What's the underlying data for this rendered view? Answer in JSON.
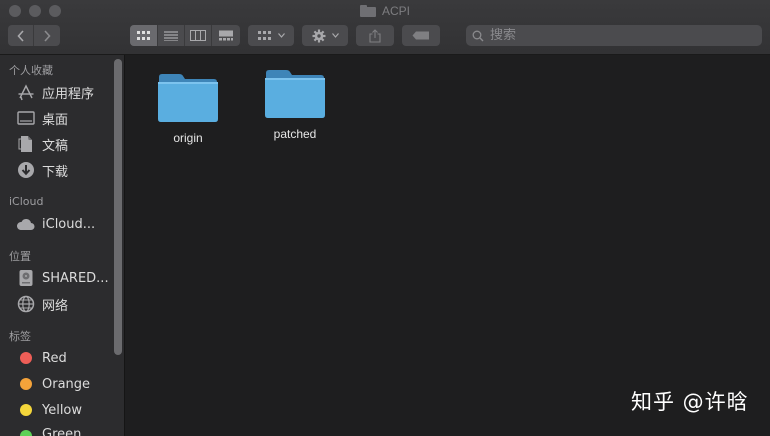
{
  "window": {
    "title": "ACPI"
  },
  "toolbar": {
    "back_icon": "chevron-left-icon",
    "forward_icon": "chevron-right-icon",
    "view_modes": [
      "icon-view",
      "list-view",
      "column-view",
      "gallery-view"
    ],
    "group_icon": "group-icon",
    "action_icon": "gear-icon",
    "share_icon": "share-icon",
    "tag_icon": "tag-icon"
  },
  "search": {
    "placeholder": "搜索"
  },
  "sidebar": {
    "favorites": {
      "heading": "个人收藏",
      "items": [
        {
          "label": "应用程序",
          "icon": "applications-icon"
        },
        {
          "label": "桌面",
          "icon": "desktop-icon"
        },
        {
          "label": "文稿",
          "icon": "documents-icon"
        },
        {
          "label": "下载",
          "icon": "downloads-icon"
        }
      ]
    },
    "icloud": {
      "heading": "iCloud",
      "items": [
        {
          "label": "iCloud...",
          "icon": "cloud-icon"
        }
      ]
    },
    "locations": {
      "heading": "位置",
      "items": [
        {
          "label": "SHARED...",
          "icon": "drive-icon"
        },
        {
          "label": "网络",
          "icon": "network-icon"
        }
      ]
    },
    "tags": {
      "heading": "标签",
      "items": [
        {
          "label": "Red",
          "color": "#ee5e57"
        },
        {
          "label": "Orange",
          "color": "#f5a33a"
        },
        {
          "label": "Yellow",
          "color": "#f4d63b"
        },
        {
          "label": "Green",
          "color": "#5cd156"
        }
      ]
    }
  },
  "content": {
    "items": [
      {
        "name": "origin",
        "kind": "folder"
      },
      {
        "name": "patched",
        "kind": "folder"
      }
    ]
  },
  "watermark": "知乎 @许晗"
}
